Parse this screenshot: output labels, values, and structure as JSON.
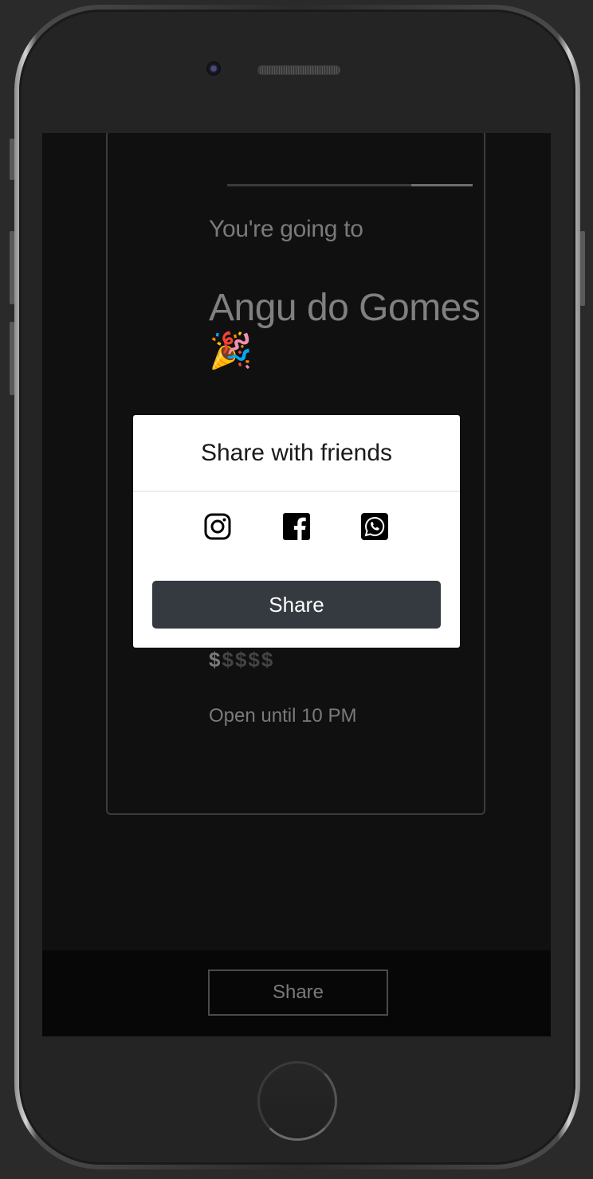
{
  "card": {
    "progress": 0.25,
    "subtitle": "You're going to",
    "venue_name": "Angu do Gomes",
    "celebration_emoji": "🎉",
    "price_symbols": [
      "$",
      "$",
      "$",
      "$",
      "$"
    ],
    "price_level": 1,
    "hours": "Open until 10 PM"
  },
  "modal": {
    "title": "Share with friends",
    "icons": [
      "instagram-icon",
      "facebook-icon",
      "whatsapp-icon"
    ],
    "share_label": "Share"
  },
  "bottom_bar": {
    "share_label": "Share"
  },
  "colors": {
    "screen_bg": "#101010",
    "modal_button": "#343a40"
  }
}
